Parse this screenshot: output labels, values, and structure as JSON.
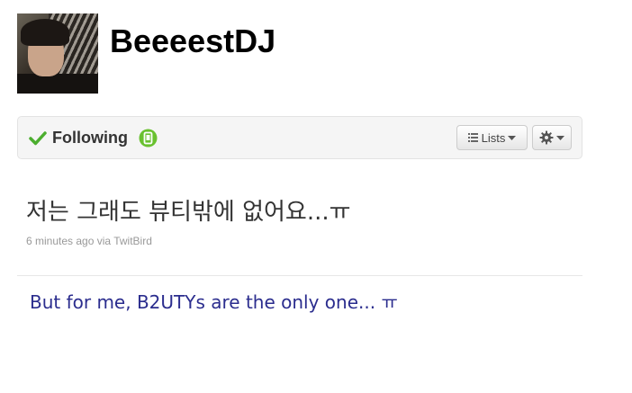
{
  "profile": {
    "screen_name": "BeeeestDJ",
    "avatar_icon": "profile-photo"
  },
  "actions": {
    "following_label": "Following",
    "following_icon": "checkmark-icon",
    "device_icon": "device-notifications-icon",
    "lists_label": "Lists",
    "gear_icon": "gear-icon",
    "colors": {
      "check": "#4cae2f",
      "device": "#69c12f"
    }
  },
  "tweet": {
    "text": "저는 그래도 뷰티밖에 없어요...ㅠ",
    "time": "6 minutes ago",
    "via": "via",
    "client": "TwitBird"
  },
  "translation": {
    "text": "But for me, B2UTYs are the only one... ㅠ",
    "color": "#2b2d8e"
  }
}
